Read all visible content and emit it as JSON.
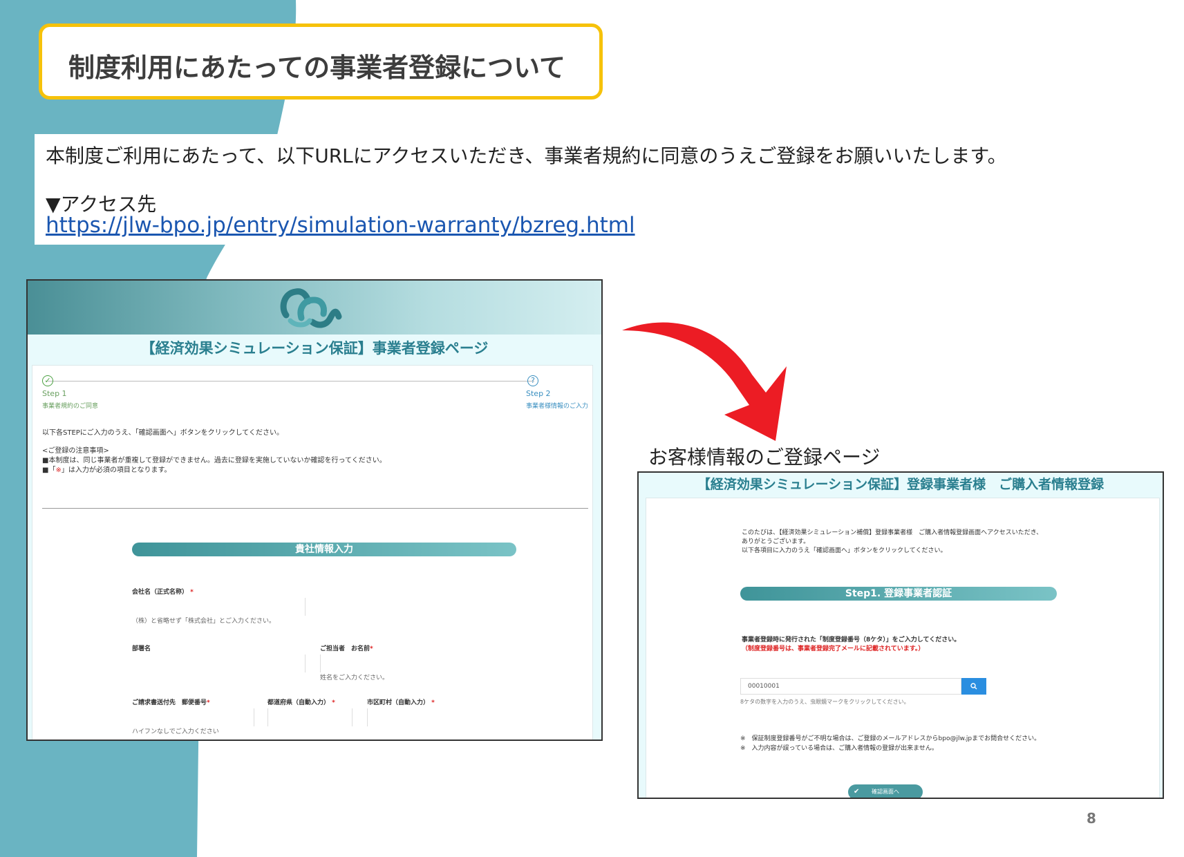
{
  "colors": {
    "teal_background": "#6ab4c2",
    "title_border": "#f6c20a",
    "link": "#1a56b0",
    "arrow": "#ec1c24",
    "teal_accent": "#2a7f8f"
  },
  "slide": {
    "title": "制度利用にあたっての事業者登録について",
    "intro_text": "本制度ご利用にあたって、以下URLにアクセスいただき、事業者規約に同意のうえご登録をお願いいたします。",
    "access_label": "▼アクセス先",
    "access_url": "https://jlw-bpo.jp/entry/simulation-warranty/bzreg.html",
    "caption_customer_page": "お客様情報のご登録ページ",
    "page_number": "8"
  },
  "shot1": {
    "logo_icon": "mcw-logo-icon",
    "title": "【経済効果シミュレーション保証】事業者登録ページ",
    "step1_label": "Step 1",
    "step1_sub": "事業者規約のご同意",
    "step2_label": "Step 2",
    "step2_sub": "事業者様情報のご入力",
    "instruction": "以下各STEPにご入力のうえ、「確認画面へ」ボタンをクリックしてください。",
    "notes_heading": "<ご登録の注意事項>",
    "note1": "■本制度は、同じ事業者が重複して登録ができません。過去に登録を実施していないか確認を行ってください。",
    "note2_prefix": "■「",
    "note2_mark": "※",
    "note2_suffix": "」は入力が必須の項目となります。",
    "section_title": "貴社情報入力",
    "company_label": "会社名（正式名称）",
    "required_mark": "*",
    "company_hint": "（株）と省略せず「株式会社」とご入力ください。",
    "department_label": "部署名",
    "contact_label": "ご担当者　お名前",
    "contact_hint": "姓名をご入力ください。",
    "postal_label": "ご請求書送付先　郵便番号",
    "prefecture_label": "都道府県（自動入力）",
    "city_label": "市区町村（自動入力）",
    "postal_hint": "ハイフンなしでご入力ください"
  },
  "shot2": {
    "title": "【経済効果シミュレーション保証】登録事業者様　ご購入者情報登録",
    "intro1": "このたびは、【経済効果シミュレーション補償】登録事業者様　ご購入者情報登録画面へアクセスいただき、",
    "intro2": "ありがとうございます。",
    "intro3": "以下各項目に入力のうえ「確認画面へ」ボタンをクリックしてください。",
    "section_title": "Step1. 登録事業者認証",
    "instruction": "事業者登録時に発行された「制度登録番号（8ケタ）」をご入力してください。",
    "instruction_red": "（制度登録番号は、事業者登録完了メールに記載されています。）",
    "input_value": "00010001",
    "search_icon": "search-icon",
    "input_hint": "8ケタの数字を入力のうえ、虫眼鏡マークをクリックしてください。",
    "note1": "※　保証制度登録番号がご不明な場合は、ご登録のメールアドレスからbpo@jlw.jpまでお問合せください。",
    "note2": "※　入力内容が誤っている場合は、ご購入者情報の登録が出来ません。",
    "confirm_button": "確認画面へ",
    "check_icon": "check-icon"
  }
}
